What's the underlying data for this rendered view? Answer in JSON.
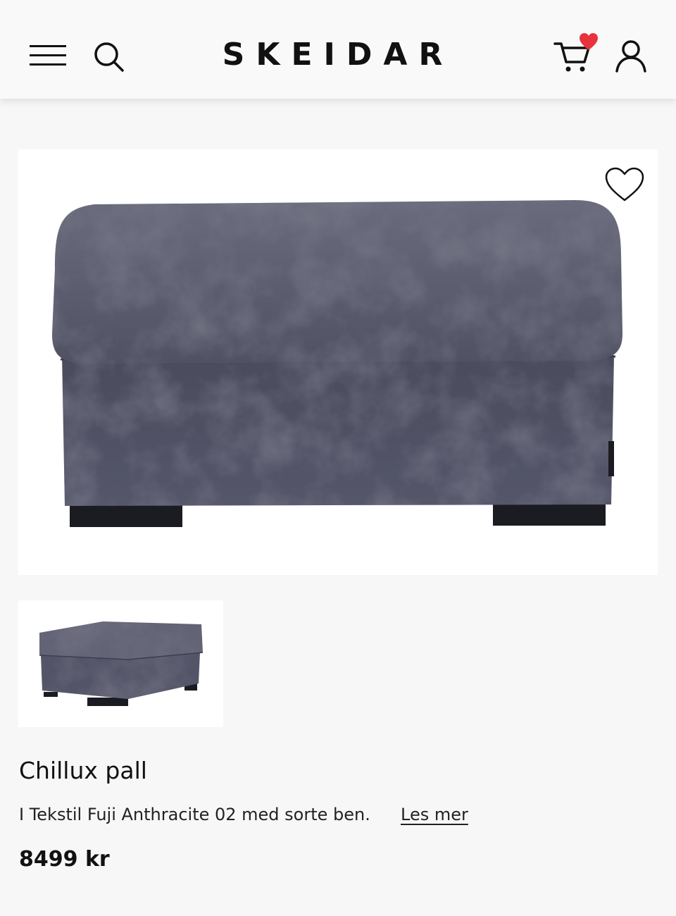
{
  "header": {
    "logo": "SKEIDAR",
    "menu_icon": "hamburger-menu-icon",
    "search_icon": "search-icon",
    "cart_icon": "shopping-cart-icon",
    "cart_badge_icon": "heart-badge-icon",
    "user_icon": "user-account-icon"
  },
  "product": {
    "favorite_icon": "heart-outline-icon",
    "title": "Chillux pall",
    "description": "I Tekstil Fuji Anthracite 02 med sorte ben.",
    "read_more": "Les mer",
    "price": "8499 kr"
  },
  "colors": {
    "background": "#f7f7f7",
    "badge": "#e8323c",
    "fabric": "#55566a"
  }
}
